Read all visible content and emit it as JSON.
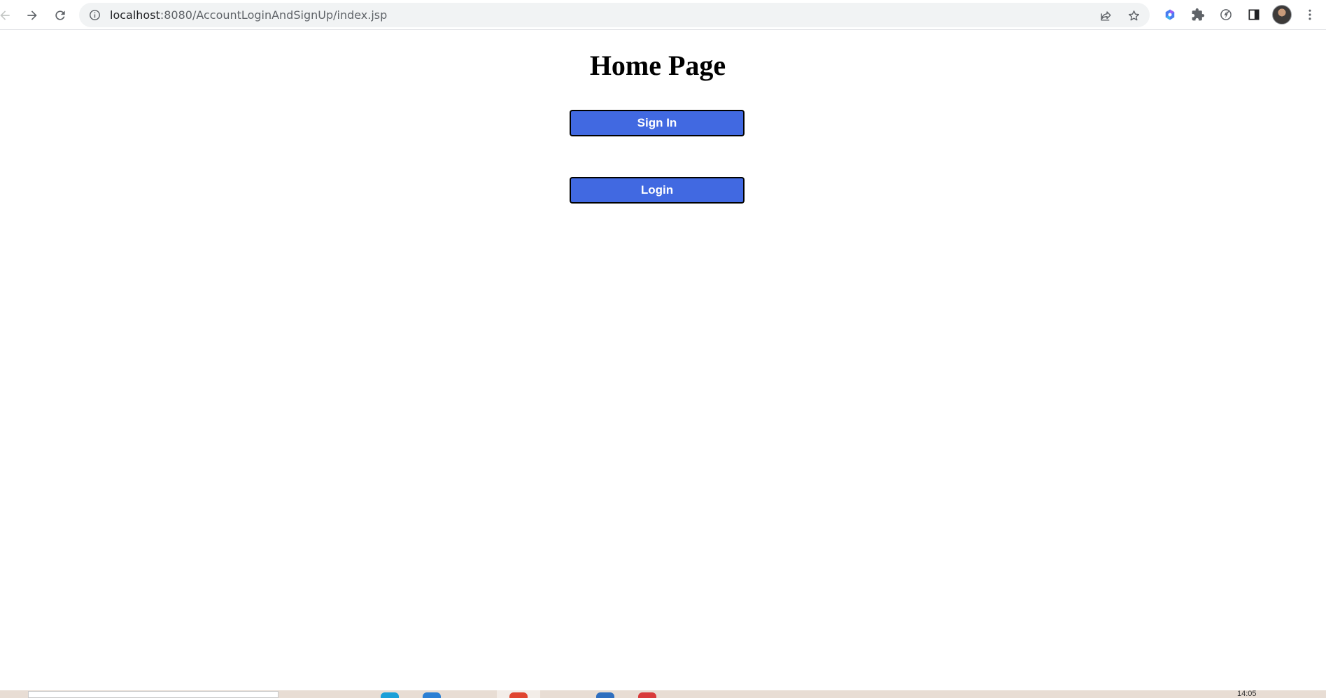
{
  "browser": {
    "url_host": "localhost",
    "url_rest": ":8080/AccountLoginAndSignUp/index.jsp"
  },
  "icons": {
    "back": "back-arrow-icon",
    "forward": "forward-arrow-icon",
    "reload": "reload-icon",
    "site_info": "info-icon",
    "share": "share-icon",
    "bookmark": "star-icon",
    "extension_1": "colorful-extension-icon",
    "extensions": "puzzle-icon",
    "performance": "speed-icon",
    "side_panel": "side-panel-icon",
    "profile": "avatar",
    "menu": "kebab-menu-icon"
  },
  "page": {
    "title": "Home Page",
    "sign_in_label": "Sign In",
    "login_label": "Login"
  },
  "colors": {
    "button_bg": "#4169e1",
    "button_text": "#ffffff",
    "button_border": "#000000"
  },
  "taskbar": {
    "clock": "14:05"
  }
}
